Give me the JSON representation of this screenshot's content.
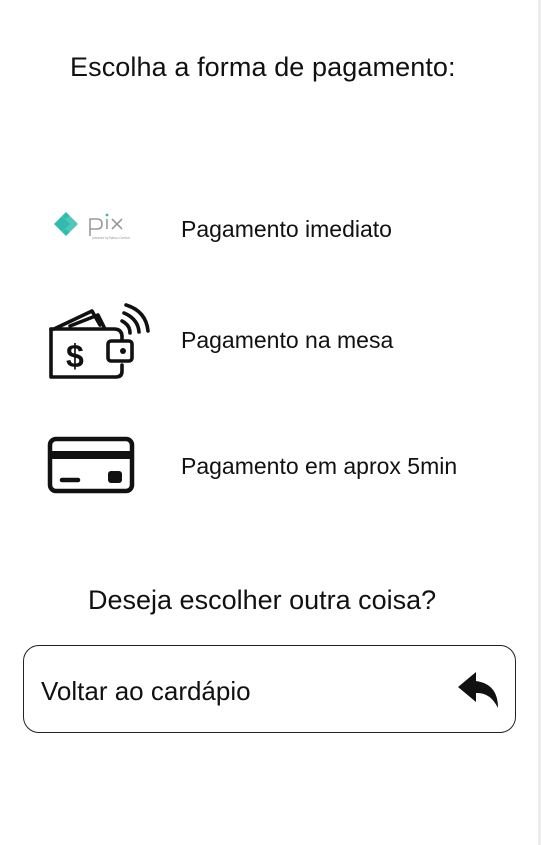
{
  "header": {
    "title": "Escolha a forma de pagamento:"
  },
  "payment_options": [
    {
      "icon": "pix-logo-icon",
      "label": "Pagamento imediato"
    },
    {
      "icon": "wallet-contactless-icon",
      "label": "Pagamento na mesa"
    },
    {
      "icon": "credit-card-icon",
      "label": "Pagamento em aprox 5min"
    }
  ],
  "pix_logo": {
    "text": "pix",
    "tagline": "powered by Banco Central",
    "brand_color": "#32BCAD"
  },
  "footer": {
    "question": "Deseja escolher outra coisa?",
    "back_button": {
      "label": "Voltar ao cardápio",
      "icon": "reply-arrow-icon"
    }
  }
}
